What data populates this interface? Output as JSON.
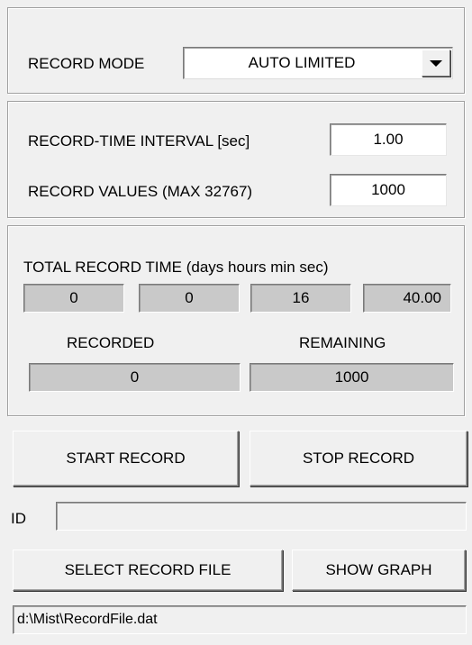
{
  "record_mode": {
    "label": "RECORD MODE",
    "value": "AUTO LIMITED"
  },
  "interval": {
    "label": "RECORD-TIME INTERVAL [sec]",
    "value": "1.00"
  },
  "values": {
    "label": "RECORD VALUES (MAX 32767)",
    "value": "1000"
  },
  "total_time": {
    "label": "TOTAL RECORD TIME (days  hours  min sec)",
    "days": "0",
    "hours": "0",
    "min": "16",
    "sec": "40.00"
  },
  "recorded": {
    "label": "RECORDED",
    "value": "0"
  },
  "remaining": {
    "label": "REMAINING",
    "value": "1000"
  },
  "buttons": {
    "start": "START RECORD",
    "stop": "STOP RECORD",
    "select_file": "SELECT RECORD FILE",
    "show_graph": "SHOW GRAPH"
  },
  "id": {
    "label": "ID",
    "value": ""
  },
  "file_path": "d:\\Mist\\RecordFile.dat"
}
